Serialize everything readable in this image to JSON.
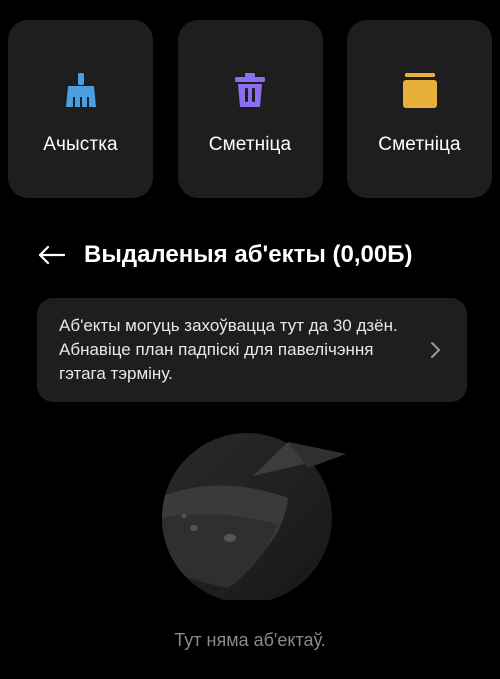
{
  "tiles": [
    {
      "label": "Ачыстка",
      "icon": "broom-icon",
      "color": "#4a9fe0"
    },
    {
      "label": "Сметніца",
      "icon": "trash-icon",
      "color": "#8c6ff0"
    },
    {
      "label": "Сметніца",
      "icon": "box-icon",
      "color": "#e8b03b"
    }
  ],
  "header": {
    "title": "Выдаленыя аб'екты (0,00Б)",
    "back_icon": "arrow-left-icon"
  },
  "notice": {
    "text": "Аб'екты могуць захоўвацца тут да 30 дзён. Абнавіце план падпіскі для павелічэння гэтага тэрміну.",
    "chevron_icon": "chevron-right-icon"
  },
  "empty_state": {
    "text": "Тут няма аб'ектаў.",
    "illustration": "planet-paper-plane-illustration"
  }
}
